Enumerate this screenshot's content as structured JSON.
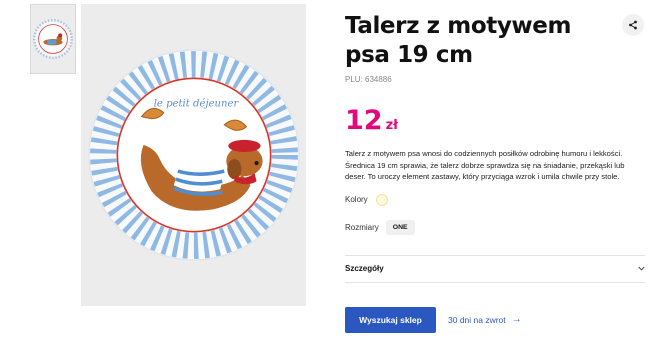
{
  "product": {
    "title": "Talerz z motywem psa 19 cm",
    "plu": "PLU: 634886",
    "price_value": "12",
    "price_currency": "zł",
    "description": "Talerz z motywem psa wnosi do codziennych posiłków odrobinę humoru i lekkości. Średnica 19 cm sprawia, że talerz dobrze sprawdza się na śniadanie, przekąski lub deser. To uroczy element zastawy, który przyciąga wzrok i umila chwile przy stole.",
    "colors_label": "Kolory",
    "selected_color": "#fffbd9",
    "sizes_label": "Rozmiary",
    "size_option": "ONE",
    "details_label": "Szczegóły",
    "plate_text": "le petit déjeuner"
  },
  "actions": {
    "find_store": "Wyszukaj sklep",
    "returns": "30 dni na zwrot",
    "returns_arrow": "→"
  },
  "colors": {
    "price": "#e4087d",
    "primary": "#2a57c0"
  }
}
